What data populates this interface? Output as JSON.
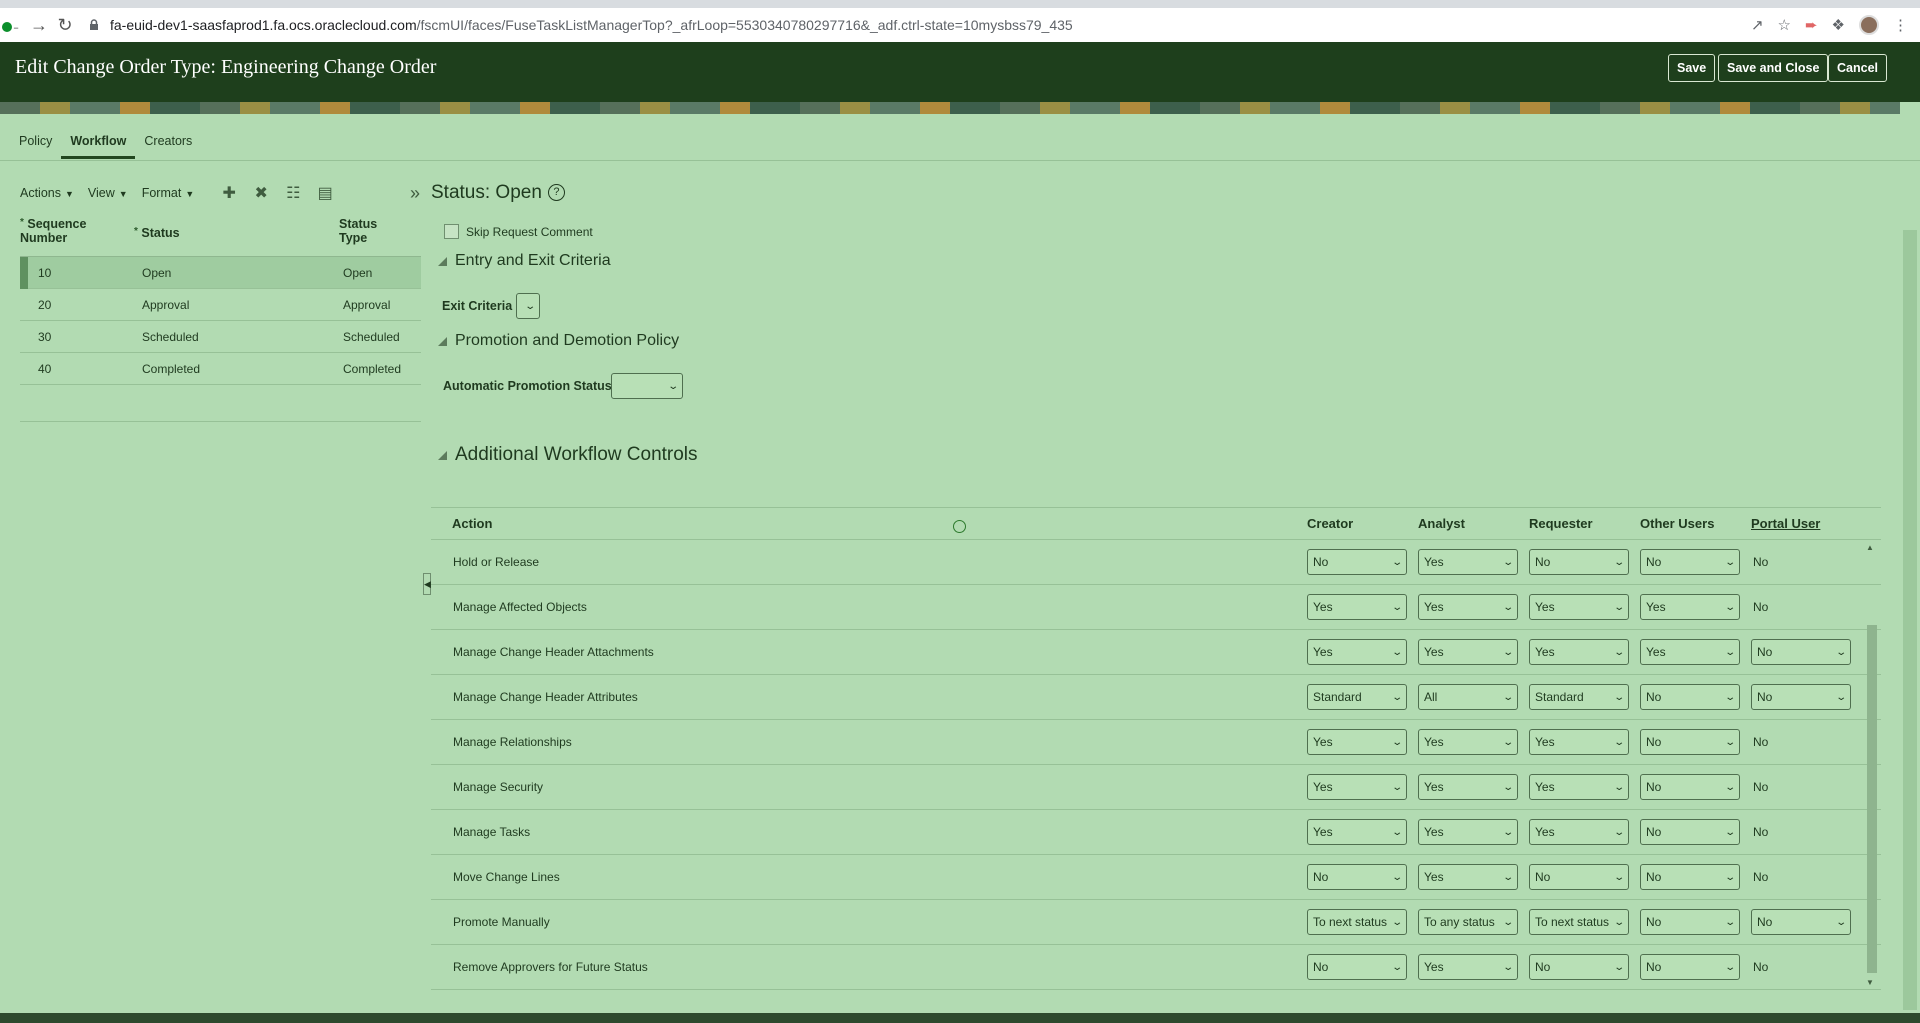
{
  "browser": {
    "url_host": "fa-euid-dev1-saasfaprod1.fa.ocs.oraclecloud.com",
    "url_path": "/fscmUI/faces/FuseTaskListManagerTop?_afrLoop=5530340780297716&_adf.ctrl-state=10mysbss79_435"
  },
  "header": {
    "title": "Edit Change Order Type: Engineering Change Order",
    "save": "Save",
    "save_close": "Save and Close",
    "cancel": "Cancel"
  },
  "tabs": [
    {
      "label": "Policy"
    },
    {
      "label": "Workflow"
    },
    {
      "label": "Creators"
    }
  ],
  "toolbar": {
    "actions": "Actions",
    "view": "View",
    "format": "Format"
  },
  "status_grid": {
    "headers": {
      "seq_line1": "Sequence",
      "seq_line2": "Number",
      "status": "Status",
      "type_line1": "Status",
      "type_line2": "Type"
    },
    "rows": [
      {
        "seq": "10",
        "status": "Open",
        "type": "Open"
      },
      {
        "seq": "20",
        "status": "Approval",
        "type": "Approval"
      },
      {
        "seq": "30",
        "status": "Scheduled",
        "type": "Scheduled"
      },
      {
        "seq": "40",
        "status": "Completed",
        "type": "Completed"
      }
    ]
  },
  "detail": {
    "title": "Status: Open",
    "skip_request_comment": "Skip Request Comment",
    "entry_exit": "Entry and Exit Criteria",
    "exit_criteria_label": "Exit Criteria",
    "promotion_policy": "Promotion and Demotion Policy",
    "auto_promotion_label": "Automatic Promotion Status",
    "additional_controls": "Additional Workflow Controls"
  },
  "workflow_table": {
    "headers": {
      "action": "Action",
      "creator": "Creator",
      "analyst": "Analyst",
      "requester": "Requester",
      "other": "Other Users",
      "portal": "Portal User"
    },
    "rows": [
      {
        "action": "Hold or Release",
        "creator": "No",
        "analyst": "Yes",
        "requester": "No",
        "other": "No",
        "portal": "No"
      },
      {
        "action": "Manage Affected Objects",
        "creator": "Yes",
        "analyst": "Yes",
        "requester": "Yes",
        "other": "Yes",
        "portal": "No"
      },
      {
        "action": "Manage Change Header Attachments",
        "creator": "Yes",
        "analyst": "Yes",
        "requester": "Yes",
        "other": "Yes",
        "portal": "No"
      },
      {
        "action": "Manage Change Header Attributes",
        "creator": "Standard",
        "analyst": "All",
        "requester": "Standard",
        "other": "No",
        "portal": "No"
      },
      {
        "action": "Manage Relationships",
        "creator": "Yes",
        "analyst": "Yes",
        "requester": "Yes",
        "other": "No",
        "portal": "No"
      },
      {
        "action": "Manage Security",
        "creator": "Yes",
        "analyst": "Yes",
        "requester": "Yes",
        "other": "No",
        "portal": "No"
      },
      {
        "action": "Manage Tasks",
        "creator": "Yes",
        "analyst": "Yes",
        "requester": "Yes",
        "other": "No",
        "portal": "No"
      },
      {
        "action": "Move Change Lines",
        "creator": "No",
        "analyst": "Yes",
        "requester": "No",
        "other": "No",
        "portal": "No"
      },
      {
        "action": "Promote Manually",
        "creator": "To next status",
        "analyst": "To any status",
        "requester": "To next status",
        "other": "No",
        "portal": "No"
      },
      {
        "action": "Remove Approvers for Future Status",
        "creator": "No",
        "analyst": "Yes",
        "requester": "No",
        "other": "No",
        "portal": "No"
      }
    ]
  }
}
